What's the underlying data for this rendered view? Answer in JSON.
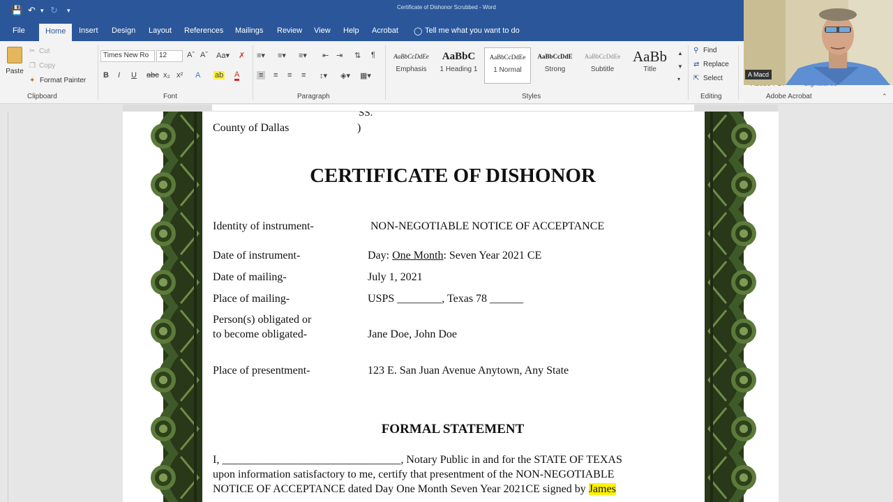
{
  "window": {
    "title": "Certificate of Dishonor Scrubbed - Word"
  },
  "tabs": [
    "File",
    "Home",
    "Insert",
    "Design",
    "Layout",
    "References",
    "Mailings",
    "Review",
    "View",
    "Help",
    "Acrobat"
  ],
  "tell_me": "Tell me what you want to do",
  "clipboard": {
    "paste": "Paste",
    "cut": "Cut",
    "copy": "Copy",
    "format_painter": "Format Painter",
    "label": "Clipboard"
  },
  "font": {
    "name": "Times New Ro",
    "size": "12",
    "label": "Font"
  },
  "paragraph": {
    "label": "Paragraph"
  },
  "styles": {
    "label": "Styles",
    "items": [
      {
        "preview": "AaBbCcDdEe",
        "name": "Emphasis"
      },
      {
        "preview": "AaBbC",
        "name": "1 Heading 1"
      },
      {
        "preview": "AaBbCcDdEe",
        "name": "1 Normal"
      },
      {
        "preview": "AaBbCcDdE",
        "name": "Strong"
      },
      {
        "preview": "AaBbCcDdEe",
        "name": "Subtitle"
      },
      {
        "preview": "AaBb",
        "name": "Title"
      }
    ]
  },
  "editing": {
    "find": "Find",
    "replace": "Replace",
    "select": "Select",
    "label": "Editing"
  },
  "acrobat": {
    "label": "Adobe Acrobat",
    "create_pdf": "Adobe PDF",
    "signatures": "Signatures"
  },
  "webcam": {
    "name": "A Macd"
  },
  "document": {
    "ss": "SS.",
    "county": "County of Dallas",
    "paren": ")",
    "title": "CERTIFICATE OF DISHONOR",
    "fields": [
      {
        "label": "Identity of instrument-",
        "value": "NON-NEGOTIABLE NOTICE OF ACCEPTANCE"
      },
      {
        "label": "Date of instrument-",
        "value_pre": "Day: ",
        "value_u": "One  Month",
        "value_post": ": Seven Year 2021 CE"
      },
      {
        "label": "Date of mailing-",
        "value": "July 1, 2021"
      },
      {
        "label": "Place of mailing-",
        "value": "USPS ________, Texas 78 ______"
      },
      {
        "label1": "Person(s) obligated or",
        "label2": "to become obligated-",
        "value": "Jane Doe, John Doe"
      },
      {
        "label": "Place of presentment-",
        "value": "123 E. San Juan Avenue Anytown, Any State"
      }
    ],
    "formal_heading": "FORMAL STATEMENT",
    "body_line1": "I, ________________________________, Notary Public in and for the STATE OF TEXAS",
    "body_line2": "upon information satisfactory to me, certify that presentment of the NON-NEGOTIABLE",
    "body_line3_pre": "NOTICE OF ACCEPTANCE dated Day One Month Seven Year 2021CE signed by ",
    "body_line3_hl": "James"
  }
}
